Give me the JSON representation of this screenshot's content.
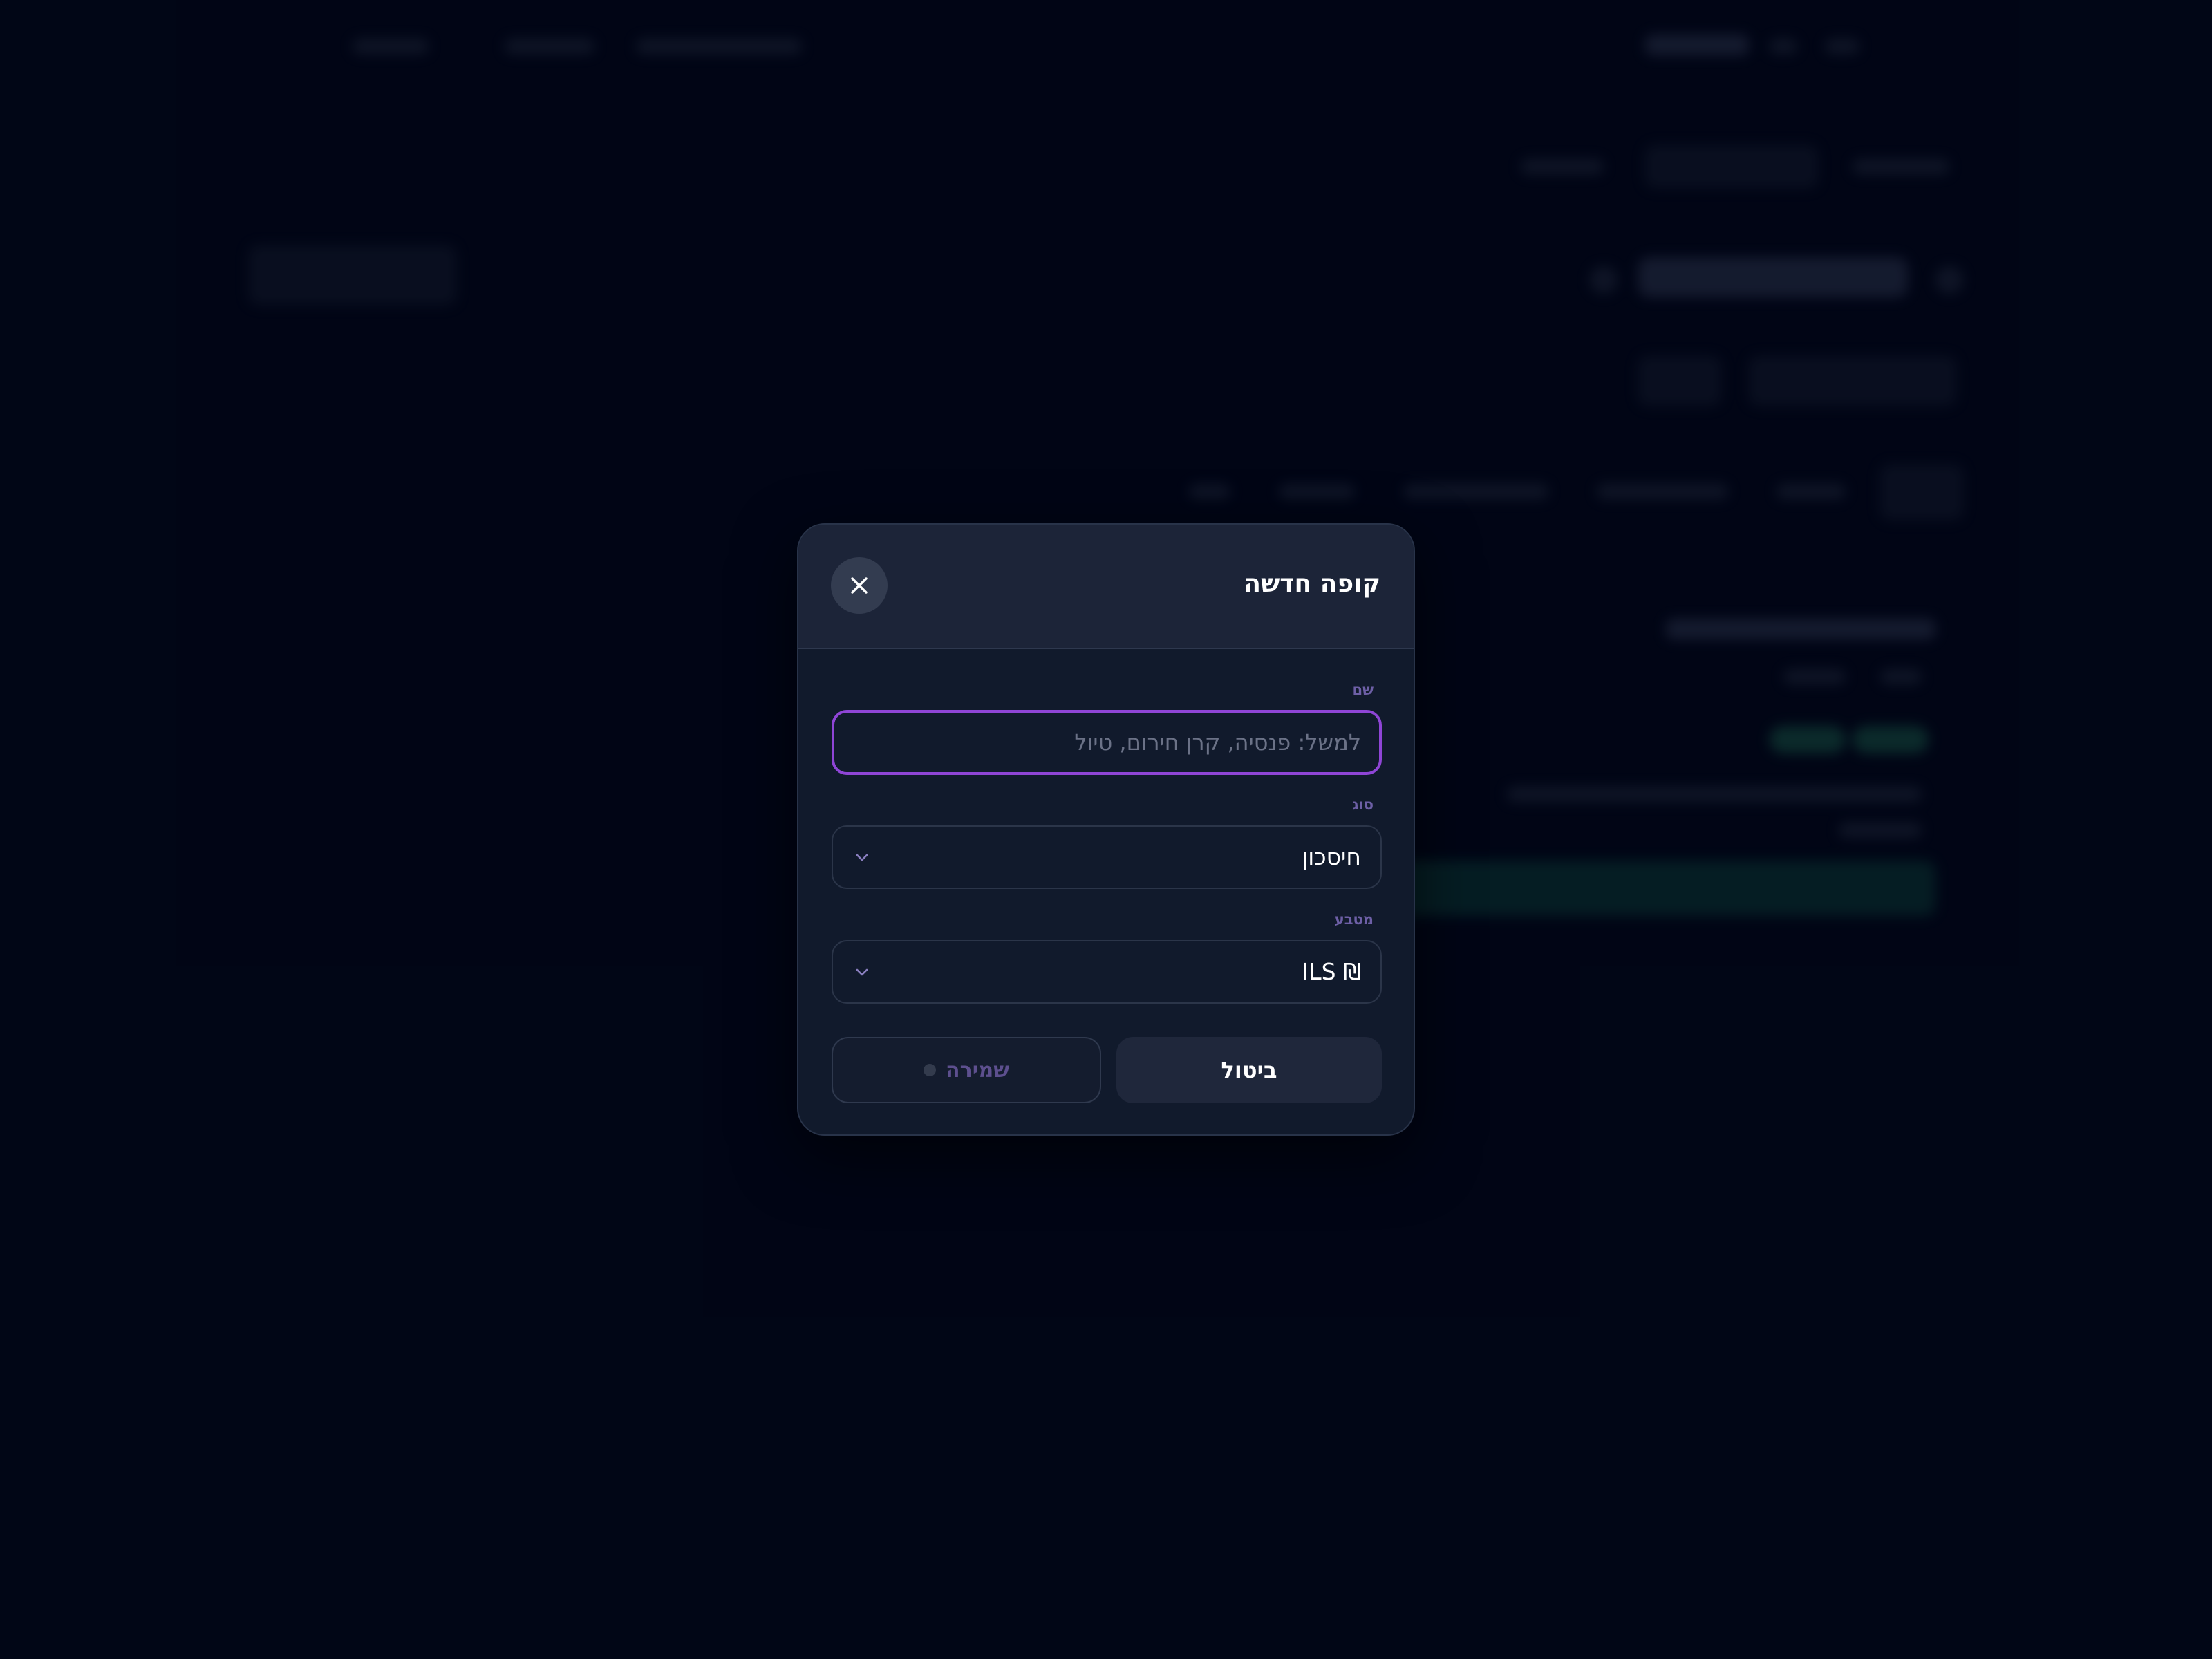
{
  "dialog": {
    "title": "קופה חדשה",
    "close_icon": "close-icon",
    "name_field": {
      "label": "שם",
      "value": "",
      "placeholder": "למשל: פנסיה, קרן חירום, טיול"
    },
    "type_field": {
      "label": "סוג",
      "selected": "חיסכון"
    },
    "currency_field": {
      "label": "מטבע",
      "selected": "₪ ILS"
    },
    "buttons": {
      "cancel_label": "ביטול",
      "save_label": "שמירה"
    }
  },
  "colors": {
    "background": "#02071a",
    "modal": "#111a2c",
    "modal_header": "#1c2438",
    "accent": "#8f45d6",
    "label": "#6d5fa6"
  }
}
